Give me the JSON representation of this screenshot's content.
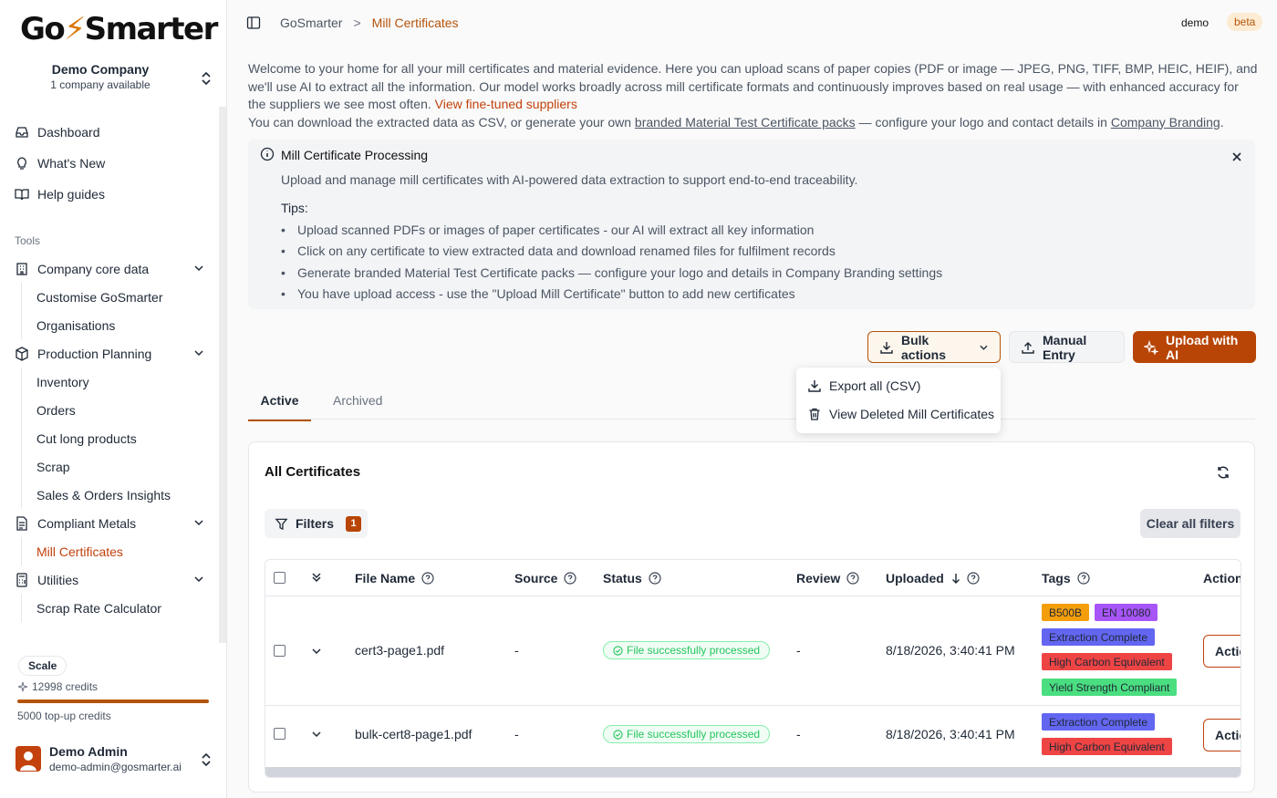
{
  "brand": {
    "logo_text_1": "Go",
    "logo_text_2": "Smarter"
  },
  "company": {
    "name": "Demo Company",
    "sub": "1 company available"
  },
  "nav_top": [
    {
      "label": "Dashboard",
      "icon": "inbox-icon"
    },
    {
      "label": "What's New",
      "icon": "lightbulb-icon"
    },
    {
      "label": "Help guides",
      "icon": "book-icon"
    }
  ],
  "tools_label": "Tools",
  "groups": {
    "company_core": {
      "label": "Company core data",
      "items": [
        "Customise GoSmarter",
        "Organisations"
      ]
    },
    "production": {
      "label": "Production Planning",
      "items": [
        "Inventory",
        "Orders",
        "Cut long products",
        "Scrap",
        "Sales & Orders Insights"
      ]
    },
    "compliant": {
      "label": "Compliant Metals",
      "items": [
        "Mill Certificates"
      ]
    },
    "utilities": {
      "label": "Utilities",
      "items": [
        "Scrap Rate Calculator"
      ]
    }
  },
  "plan": {
    "name": "Scale",
    "credits": "12998 credits",
    "credit_fraction": 1.0,
    "topup": "5000 top-up credits"
  },
  "user": {
    "name": "Demo Admin",
    "email": "demo-admin@gosmarter.ai"
  },
  "header": {
    "crumb_root": "GoSmarter",
    "crumb_sep": ">",
    "crumb_current": "Mill Certificates",
    "account": "demo",
    "badge": "beta"
  },
  "intro": {
    "p1": "Welcome to your home for all your mill certificates and material evidence. Here you can upload scans of paper copies (PDF or image — JPEG, PNG, TIFF, BMP, HEIC, HEIF), and we'll use AI to extract all the information. Our model works broadly across mill certificate formats and continuously improves based on real usage — with enhanced accuracy for the suppliers we see most often. ",
    "p1_link": "View fine-tuned suppliers",
    "p2_a": "You can download the extracted data as CSV, or generate your own ",
    "p2_link1": "branded Material Test Certificate packs",
    "p2_b": " — configure your logo and contact details in ",
    "p2_link2": "Company Branding",
    "p2_c": "."
  },
  "alert": {
    "title": "Mill Certificate Processing",
    "desc": "Upload and manage mill certificates with AI-powered data extraction to support end-to-end traceability.",
    "tips_label": "Tips:",
    "tips": [
      "Upload scanned PDFs or images of paper certificates - our AI will extract all key information",
      "Click on any certificate to view extracted data and download renamed files for fulfilment records",
      "Generate branded Material Test Certificate packs — configure your logo and details in Company Branding settings",
      "You have upload access - use the \"Upload Mill Certificate\" button to add new certificates"
    ]
  },
  "actions": {
    "bulk": "Bulk actions",
    "manual": "Manual Entry",
    "upload": "Upload with AI"
  },
  "bulk_menu": [
    "Export all (CSV)",
    "View Deleted Mill Certificates"
  ],
  "tabs": [
    "Active",
    "Archived"
  ],
  "card": {
    "title": "All Certificates",
    "filters_label": "Filters",
    "filters_count": "1",
    "clear_label": "Clear all filters"
  },
  "table": {
    "headers": {
      "file": "File Name",
      "source": "Source",
      "status": "Status",
      "review": "Review",
      "uploaded": "Uploaded",
      "tags": "Tags",
      "actions": "Actions"
    },
    "rows": [
      {
        "file": "cert3-page1.pdf",
        "source": "-",
        "status": "File successfully processed",
        "review": "-",
        "uploaded": "8/18/2026, 3:40:41 PM",
        "tags": [
          {
            "label": "B500B",
            "color": "#f59e0b"
          },
          {
            "label": "EN 10080",
            "color": "#a855f7"
          },
          {
            "label": "Extraction Complete",
            "color": "#6366f1"
          },
          {
            "label": "High Carbon Equivalent",
            "color": "#ef4444"
          },
          {
            "label": "Yield Strength Compliant",
            "color": "#4ade80"
          }
        ],
        "action": "Actions"
      },
      {
        "file": "bulk-cert8-page1.pdf",
        "source": "-",
        "status": "File successfully processed",
        "review": "-",
        "uploaded": "8/18/2026, 3:40:41 PM",
        "tags": [
          {
            "label": "Extraction Complete",
            "color": "#6366f1"
          },
          {
            "label": "High Carbon Equivalent",
            "color": "#ef4444"
          }
        ],
        "action": "Actions"
      }
    ]
  },
  "colors": {
    "accent": "#b45309",
    "primary_button": "#b84506",
    "success": "#22c55e"
  }
}
